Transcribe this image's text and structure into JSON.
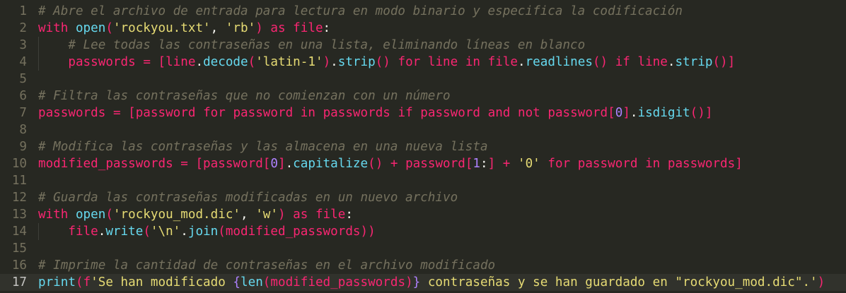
{
  "editor": {
    "current_line": 17,
    "colors": {
      "background": "#272822",
      "keyword": "#f92672",
      "builtin": "#66d9ef",
      "string": "#e6db74",
      "number": "#ae81ff",
      "comment": "#75715e",
      "text": "#f8f8f2"
    },
    "lines": [
      {
        "n": "1",
        "guide": false,
        "tokens": [
          [
            "com",
            "# Abre el archivo de entrada para lectura en modo binario y especifica la codificación"
          ]
        ]
      },
      {
        "n": "2",
        "guide": false,
        "tokens": [
          [
            "kw",
            "with"
          ],
          [
            "plain",
            " "
          ],
          [
            "fn",
            "open"
          ],
          [
            "paren",
            "("
          ],
          [
            "str",
            "'rockyou.txt'"
          ],
          [
            "punc",
            ", "
          ],
          [
            "str",
            "'rb'"
          ],
          [
            "paren",
            ")"
          ],
          [
            "plain",
            " "
          ],
          [
            "kw",
            "as"
          ],
          [
            "plain",
            " "
          ],
          [
            "var",
            "file"
          ],
          [
            "punc",
            ":"
          ]
        ]
      },
      {
        "n": "3",
        "guide": true,
        "tokens": [
          [
            "plain",
            "    "
          ],
          [
            "com",
            "# Lee todas las contraseñas en una lista, eliminando líneas en blanco"
          ]
        ]
      },
      {
        "n": "4",
        "guide": true,
        "tokens": [
          [
            "plain",
            "    "
          ],
          [
            "var",
            "passwords"
          ],
          [
            "plain",
            " "
          ],
          [
            "kw",
            "="
          ],
          [
            "plain",
            " "
          ],
          [
            "paren",
            "["
          ],
          [
            "var",
            "line"
          ],
          [
            "punc",
            "."
          ],
          [
            "fn",
            "decode"
          ],
          [
            "paren",
            "("
          ],
          [
            "str",
            "'latin-1'"
          ],
          [
            "paren",
            ")"
          ],
          [
            "punc",
            "."
          ],
          [
            "fn",
            "strip"
          ],
          [
            "paren",
            "()"
          ],
          [
            "plain",
            " "
          ],
          [
            "kw",
            "for"
          ],
          [
            "plain",
            " "
          ],
          [
            "var",
            "line"
          ],
          [
            "plain",
            " "
          ],
          [
            "kw",
            "in"
          ],
          [
            "plain",
            " "
          ],
          [
            "var",
            "file"
          ],
          [
            "punc",
            "."
          ],
          [
            "fn",
            "readlines"
          ],
          [
            "paren",
            "()"
          ],
          [
            "plain",
            " "
          ],
          [
            "kw",
            "if"
          ],
          [
            "plain",
            " "
          ],
          [
            "var",
            "line"
          ],
          [
            "punc",
            "."
          ],
          [
            "fn",
            "strip"
          ],
          [
            "paren",
            "()]"
          ]
        ]
      },
      {
        "n": "5",
        "guide": false,
        "tokens": []
      },
      {
        "n": "6",
        "guide": false,
        "tokens": [
          [
            "com",
            "# Filtra las contraseñas que no comienzan con un número"
          ]
        ]
      },
      {
        "n": "7",
        "guide": false,
        "tokens": [
          [
            "var",
            "passwords"
          ],
          [
            "plain",
            " "
          ],
          [
            "kw",
            "="
          ],
          [
            "plain",
            " "
          ],
          [
            "paren",
            "["
          ],
          [
            "var",
            "password"
          ],
          [
            "plain",
            " "
          ],
          [
            "kw",
            "for"
          ],
          [
            "plain",
            " "
          ],
          [
            "var",
            "password"
          ],
          [
            "plain",
            " "
          ],
          [
            "kw",
            "in"
          ],
          [
            "plain",
            " "
          ],
          [
            "var",
            "passwords"
          ],
          [
            "plain",
            " "
          ],
          [
            "kw",
            "if"
          ],
          [
            "plain",
            " "
          ],
          [
            "var",
            "password"
          ],
          [
            "plain",
            " "
          ],
          [
            "kw",
            "and"
          ],
          [
            "plain",
            " "
          ],
          [
            "kw",
            "not"
          ],
          [
            "plain",
            " "
          ],
          [
            "var",
            "password"
          ],
          [
            "paren",
            "["
          ],
          [
            "num",
            "0"
          ],
          [
            "paren",
            "]"
          ],
          [
            "punc",
            "."
          ],
          [
            "fn",
            "isdigit"
          ],
          [
            "paren",
            "()]"
          ]
        ]
      },
      {
        "n": "8",
        "guide": false,
        "tokens": []
      },
      {
        "n": "9",
        "guide": false,
        "tokens": [
          [
            "com",
            "# Modifica las contraseñas y las almacena en una nueva lista"
          ]
        ]
      },
      {
        "n": "10",
        "guide": false,
        "tokens": [
          [
            "var",
            "modified_passwords"
          ],
          [
            "plain",
            " "
          ],
          [
            "kw",
            "="
          ],
          [
            "plain",
            " "
          ],
          [
            "paren",
            "["
          ],
          [
            "var",
            "password"
          ],
          [
            "paren",
            "["
          ],
          [
            "num",
            "0"
          ],
          [
            "paren",
            "]"
          ],
          [
            "punc",
            "."
          ],
          [
            "fn",
            "capitalize"
          ],
          [
            "paren",
            "()"
          ],
          [
            "plain",
            " "
          ],
          [
            "kw",
            "+"
          ],
          [
            "plain",
            " "
          ],
          [
            "var",
            "password"
          ],
          [
            "paren",
            "["
          ],
          [
            "num",
            "1"
          ],
          [
            "punc",
            ":"
          ],
          [
            "paren",
            "]"
          ],
          [
            "plain",
            " "
          ],
          [
            "kw",
            "+"
          ],
          [
            "plain",
            " "
          ],
          [
            "str",
            "'0'"
          ],
          [
            "plain",
            " "
          ],
          [
            "kw",
            "for"
          ],
          [
            "plain",
            " "
          ],
          [
            "var",
            "password"
          ],
          [
            "plain",
            " "
          ],
          [
            "kw",
            "in"
          ],
          [
            "plain",
            " "
          ],
          [
            "var",
            "passwords"
          ],
          [
            "paren",
            "]"
          ]
        ]
      },
      {
        "n": "11",
        "guide": false,
        "tokens": []
      },
      {
        "n": "12",
        "guide": false,
        "tokens": [
          [
            "com",
            "# Guarda las contraseñas modificadas en un nuevo archivo"
          ]
        ]
      },
      {
        "n": "13",
        "guide": false,
        "tokens": [
          [
            "kw",
            "with"
          ],
          [
            "plain",
            " "
          ],
          [
            "fn",
            "open"
          ],
          [
            "paren",
            "("
          ],
          [
            "str",
            "'rockyou_mod.dic'"
          ],
          [
            "punc",
            ", "
          ],
          [
            "str",
            "'w'"
          ],
          [
            "paren",
            ")"
          ],
          [
            "plain",
            " "
          ],
          [
            "kw",
            "as"
          ],
          [
            "plain",
            " "
          ],
          [
            "var",
            "file"
          ],
          [
            "punc",
            ":"
          ]
        ]
      },
      {
        "n": "14",
        "guide": true,
        "tokens": [
          [
            "plain",
            "    "
          ],
          [
            "var",
            "file"
          ],
          [
            "punc",
            "."
          ],
          [
            "fn",
            "write"
          ],
          [
            "paren",
            "("
          ],
          [
            "str",
            "'\\n'"
          ],
          [
            "punc",
            "."
          ],
          [
            "fn",
            "join"
          ],
          [
            "paren",
            "("
          ],
          [
            "var",
            "modified_passwords"
          ],
          [
            "paren",
            "))"
          ]
        ]
      },
      {
        "n": "15",
        "guide": false,
        "tokens": []
      },
      {
        "n": "16",
        "guide": false,
        "tokens": [
          [
            "com",
            "# Imprime la cantidad de contraseñas en el archivo modificado"
          ]
        ]
      },
      {
        "n": "17",
        "guide": false,
        "tokens": [
          [
            "fn",
            "print"
          ],
          [
            "paren",
            "("
          ],
          [
            "kw",
            "f"
          ],
          [
            "str",
            "'Se han modificado "
          ],
          [
            "num",
            "{"
          ],
          [
            "fn",
            "len"
          ],
          [
            "paren",
            "("
          ],
          [
            "var",
            "modified_passwords"
          ],
          [
            "paren",
            ")"
          ],
          [
            "num",
            "}"
          ],
          [
            "str",
            " contraseñas y se han guardado en \"rockyou_mod.dic\".'"
          ],
          [
            "paren",
            ")"
          ]
        ]
      }
    ]
  }
}
